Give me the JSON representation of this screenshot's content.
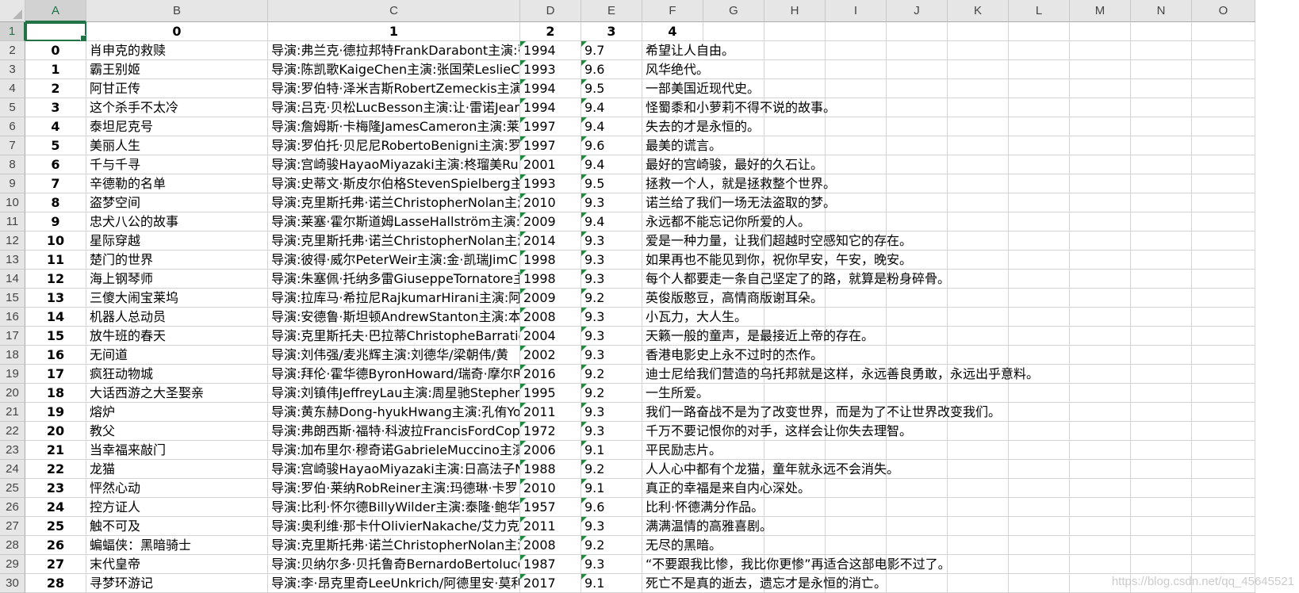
{
  "columns": [
    "A",
    "B",
    "C",
    "D",
    "E",
    "F",
    "G",
    "H",
    "I",
    "J",
    "K",
    "L",
    "M",
    "N",
    "O"
  ],
  "selected_column": "A",
  "header_row": {
    "row_num": "1",
    "a": "",
    "b": "0",
    "c": "1",
    "d": "2",
    "e": "3",
    "f": "4"
  },
  "rows": [
    {
      "r": "2",
      "a": "0",
      "b": "肖申克的救赎",
      "c": "导演:弗兰克·德拉邦特FrankDarabont主演:蒂",
      "d": "1994",
      "e": "9.7",
      "f": "希望让人自由。"
    },
    {
      "r": "3",
      "a": "1",
      "b": "霸王别姬",
      "c": "导演:陈凯歌KaigeChen主演:张国荣LeslieCh",
      "d": "1993",
      "e": "9.6",
      "f": "风华绝代。"
    },
    {
      "r": "4",
      "a": "2",
      "b": "阿甘正传",
      "c": "导演:罗伯特·泽米吉斯RobertZemeckis主演:",
      "d": "1994",
      "e": "9.5",
      "f": "一部美国近现代史。"
    },
    {
      "r": "5",
      "a": "3",
      "b": "这个杀手不太冷",
      "c": "导演:吕克·贝松LucBesson主演:让·雷诺Jean",
      "d": "1994",
      "e": "9.4",
      "f": "怪蜀黍和小萝莉不得不说的故事。"
    },
    {
      "r": "6",
      "a": "4",
      "b": "泰坦尼克号",
      "c": "导演:詹姆斯·卡梅隆JamesCameron主演:莱",
      "d": "1997",
      "e": "9.4",
      "f": "失去的才是永恒的。"
    },
    {
      "r": "7",
      "a": "5",
      "b": "美丽人生",
      "c": "导演:罗伯托·贝尼尼RobertoBenigni主演:罗",
      "d": "1997",
      "e": "9.6",
      "f": "最美的谎言。"
    },
    {
      "r": "8",
      "a": "6",
      "b": "千与千寻",
      "c": "导演:宫崎骏HayaoMiyazaki主演:柊瑠美Run",
      "d": "2001",
      "e": "9.4",
      "f": "最好的宫崎骏，最好的久石让。"
    },
    {
      "r": "9",
      "a": "7",
      "b": "辛德勒的名单",
      "c": "导演:史蒂文·斯皮尔伯格StevenSpielberg主演",
      "d": "1993",
      "e": "9.5",
      "f": "拯救一个人，就是拯救整个世界。"
    },
    {
      "r": "10",
      "a": "8",
      "b": "盗梦空间",
      "c": "导演:克里斯托弗·诺兰ChristopherNolan主演",
      "d": "2010",
      "e": "9.3",
      "f": "诺兰给了我们一场无法盗取的梦。"
    },
    {
      "r": "11",
      "a": "9",
      "b": "忠犬八公的故事",
      "c": "导演:莱塞·霍尔斯道姆LasseHallström主演:",
      "d": "2009",
      "e": "9.4",
      "f": "永远都不能忘记你所爱的人。"
    },
    {
      "r": "12",
      "a": "10",
      "b": "星际穿越",
      "c": "导演:克里斯托弗·诺兰ChristopherNolan主演",
      "d": "2014",
      "e": "9.3",
      "f": "爱是一种力量，让我们超越时空感知它的存在。"
    },
    {
      "r": "13",
      "a": "11",
      "b": "楚门的世界",
      "c": "导演:彼得·威尔PeterWeir主演:金·凯瑞JimC",
      "d": "1998",
      "e": "9.3",
      "f": "如果再也不能见到你，祝你早安，午安，晚安。"
    },
    {
      "r": "14",
      "a": "12",
      "b": "海上钢琴师",
      "c": "导演:朱塞佩·托纳多雷GiuseppeTornatore主",
      "d": "1998",
      "e": "9.3",
      "f": "每个人都要走一条自己坚定了的路，就算是粉身碎骨。"
    },
    {
      "r": "15",
      "a": "13",
      "b": "三傻大闹宝莱坞",
      "c": "导演:拉库马·希拉尼RajkumarHirani主演:阿",
      "d": "2009",
      "e": "9.2",
      "f": "英俊版憨豆，高情商版谢耳朵。"
    },
    {
      "r": "16",
      "a": "14",
      "b": "机器人总动员",
      "c": "导演:安德鲁·斯坦顿AndrewStanton主演:本",
      "d": "2008",
      "e": "9.3",
      "f": "小瓦力，大人生。"
    },
    {
      "r": "17",
      "a": "15",
      "b": "放牛班的春天",
      "c": "导演:克里斯托夫·巴拉蒂ChristopheBarratie",
      "d": "2004",
      "e": "9.3",
      "f": "天籁一般的童声，是最接近上帝的存在。"
    },
    {
      "r": "18",
      "a": "16",
      "b": "无间道",
      "c": "导演:刘伟强/麦兆辉主演:刘德华/梁朝伟/黄",
      "d": "2002",
      "e": "9.3",
      "f": "香港电影史上永不过时的杰作。"
    },
    {
      "r": "19",
      "a": "17",
      "b": "疯狂动物城",
      "c": "导演:拜伦·霍华德ByronHoward/瑞奇·摩尔R",
      "d": "2016",
      "e": "9.2",
      "f": "迪士尼给我们营造的乌托邦就是这样，永远善良勇敢，永远出乎意料。"
    },
    {
      "r": "20",
      "a": "18",
      "b": "大话西游之大圣娶亲",
      "c": "导演:刘镇伟JeffreyLau主演:周星驰Stephen",
      "d": "1995",
      "e": "9.2",
      "f": "一生所爱。"
    },
    {
      "r": "21",
      "a": "19",
      "b": "熔炉",
      "c": "导演:黄东赫Dong-hyukHwang主演:孔侑Yoo",
      "d": "2011",
      "e": "9.3",
      "f": "我们一路奋战不是为了改变世界，而是为了不让世界改变我们。"
    },
    {
      "r": "22",
      "a": "20",
      "b": "教父",
      "c": "导演:弗朗西斯·福特·科波拉FrancisFordCop",
      "d": "1972",
      "e": "9.3",
      "f": "千万不要记恨你的对手，这样会让你失去理智。"
    },
    {
      "r": "23",
      "a": "21",
      "b": "当幸福来敲门",
      "c": "导演:加布里尔·穆奇诺GabrieleMuccino主演",
      "d": "2006",
      "e": "9.1",
      "f": "平民励志片。"
    },
    {
      "r": "24",
      "a": "22",
      "b": "龙猫",
      "c": "导演:宫崎骏HayaoMiyazaki主演:日高法子N",
      "d": "1988",
      "e": "9.2",
      "f": "人人心中都有个龙猫，童年就永远不会消失。"
    },
    {
      "r": "25",
      "a": "23",
      "b": "怦然心动",
      "c": "导演:罗伯·莱纳RobReiner主演:玛德琳·卡罗",
      "d": "2010",
      "e": "9.1",
      "f": "真正的幸福是来自内心深处。"
    },
    {
      "r": "26",
      "a": "24",
      "b": "控方证人",
      "c": "导演:比利·怀尔德BillyWilder主演:泰隆·鲍华",
      "d": "1957",
      "e": "9.6",
      "f": "比利·怀德满分作品。"
    },
    {
      "r": "27",
      "a": "25",
      "b": "触不可及",
      "c": "导演:奥利维·那卡什OlivierNakache/艾力克",
      "d": "2011",
      "e": "9.3",
      "f": "满满温情的高雅喜剧。"
    },
    {
      "r": "28",
      "a": "26",
      "b": "蝙蝠侠：黑暗骑士",
      "c": "导演:克里斯托弗·诺兰ChristopherNolan主演",
      "d": "2008",
      "e": "9.2",
      "f": "无尽的黑暗。"
    },
    {
      "r": "29",
      "a": "27",
      "b": "末代皇帝",
      "c": "导演:贝纳尔多·贝托鲁奇BernardoBertolucc",
      "d": "1987",
      "e": "9.3",
      "f": "“不要跟我比惨，我比你更惨”再适合这部电影不过了。"
    },
    {
      "r": "30",
      "a": "28",
      "b": "寻梦环游记",
      "c": "导演:李·昂克里奇LeeUnkrich/阿德里安·莫利",
      "d": "2017",
      "e": "9.1",
      "f": "死亡不是真的逝去，遗忘才是永恒的消亡。"
    }
  ],
  "watermark": "https://blog.csdn.net/qq_45645521",
  "colors": {
    "accent": "#217346",
    "header_bg": "#e6e6e6",
    "grid": "#d4d4d4",
    "text_marker": "#1e8a3c"
  }
}
